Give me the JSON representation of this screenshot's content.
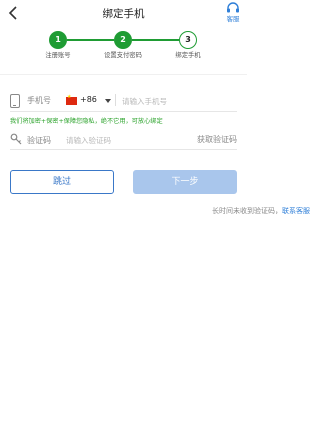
{
  "header": {
    "title": "绑定手机",
    "back_icon": "chevron-left-icon",
    "service_icon": "headset-icon",
    "service_label": "客服"
  },
  "steps": [
    {
      "number": "1",
      "label": "注册账号",
      "state": "done"
    },
    {
      "number": "2",
      "label": "设置支付密码",
      "state": "done"
    },
    {
      "number": "3",
      "label": "绑定手机",
      "state": "active"
    }
  ],
  "colors": {
    "accent_green": "#1f9c34",
    "link_blue": "#2f7fd8",
    "button_disabled": "#a9c6ec",
    "notice_green": "#2aa22a"
  },
  "phone_row": {
    "label": "手机号",
    "country_code": "+86",
    "flag": "china-flag-icon",
    "placeholder": "请输入手机号",
    "value": ""
  },
  "notice": "我们将加密+保密+保障您隐私，绝不它用，可放心绑定",
  "code_row": {
    "label": "验证码",
    "placeholder": "请输入验证码",
    "value": "",
    "get_code_label": "获取验证码"
  },
  "buttons": {
    "skip": "跳过",
    "next": "下一步"
  },
  "help": {
    "text": "长时间未收到验证码，",
    "link": "联系客服"
  }
}
